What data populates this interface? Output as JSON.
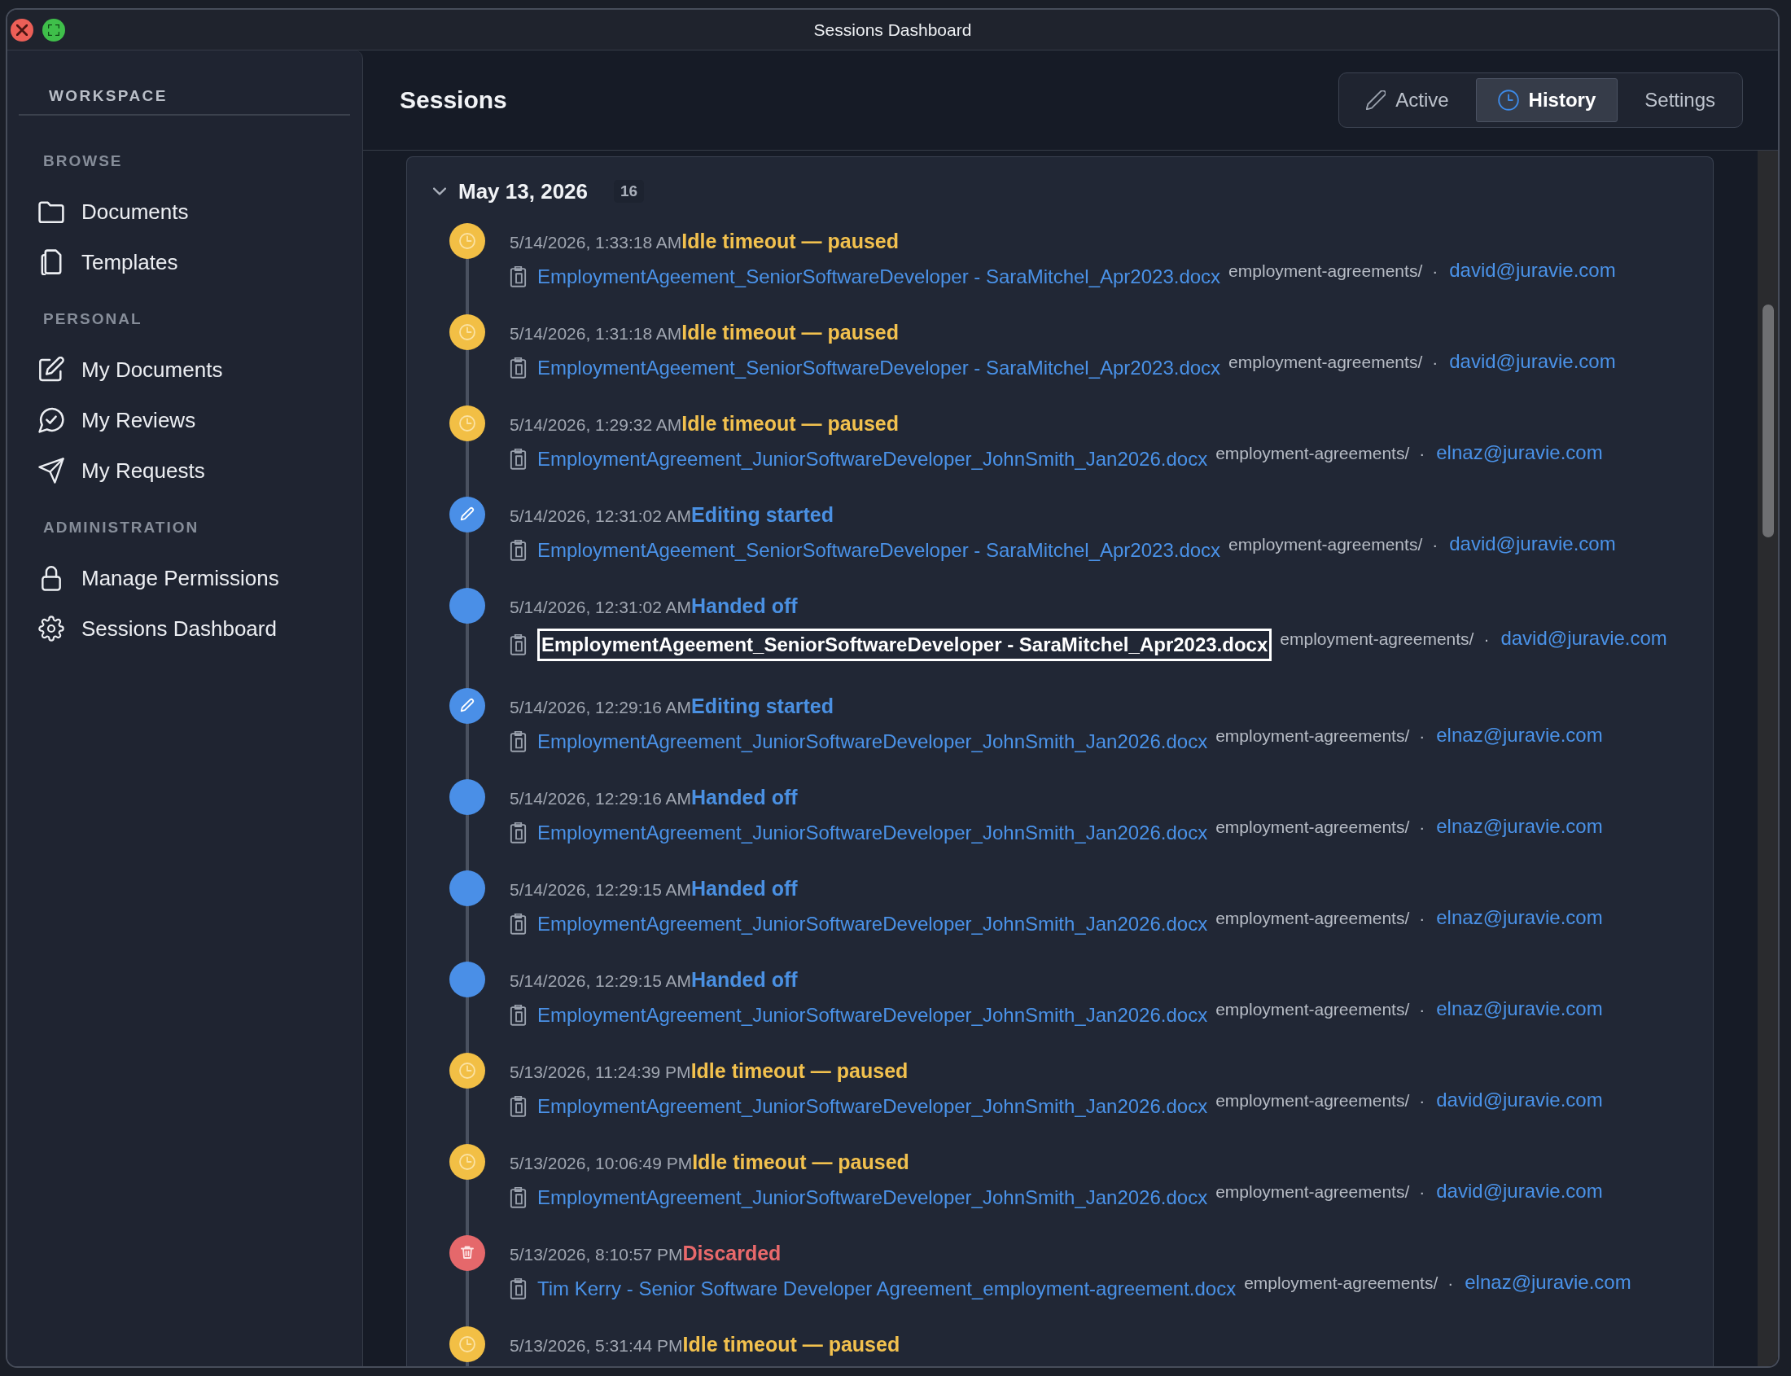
{
  "window": {
    "title": "Sessions Dashboard"
  },
  "sidebar": {
    "heading": "WORKSPACE",
    "sections": [
      {
        "label": "BROWSE",
        "items": [
          {
            "label": "Documents"
          },
          {
            "label": "Templates"
          }
        ]
      },
      {
        "label": "PERSONAL",
        "items": [
          {
            "label": "My Documents"
          },
          {
            "label": "My Reviews"
          },
          {
            "label": "My Requests"
          }
        ]
      },
      {
        "label": "ADMINISTRATION",
        "items": [
          {
            "label": "Manage Permissions"
          },
          {
            "label": "Sessions Dashboard"
          }
        ]
      }
    ]
  },
  "header": {
    "title": "Sessions",
    "tabs": [
      {
        "label": "Active",
        "selected": false
      },
      {
        "label": "History",
        "selected": true
      },
      {
        "label": "Settings",
        "selected": false
      }
    ]
  },
  "groups": [
    {
      "date": "May 13, 2026",
      "count": "16",
      "expanded": true,
      "events": [
        {
          "kind": "idle",
          "time": "5/14/2026, 1:33:18 AM",
          "title": "Idle timeout — paused",
          "file": "EmploymentAgeement_SeniorSoftwareDeveloper - SaraMitchel_Apr2023.docx",
          "folder": "employment-agreements/",
          "separator": "·",
          "user": "david@juravie.com",
          "selected": false
        },
        {
          "kind": "idle",
          "time": "5/14/2026, 1:31:18 AM",
          "title": "Idle timeout — paused",
          "file": "EmploymentAgeement_SeniorSoftwareDeveloper - SaraMitchel_Apr2023.docx",
          "folder": "employment-agreements/",
          "separator": "·",
          "user": "david@juravie.com",
          "selected": false
        },
        {
          "kind": "idle",
          "time": "5/14/2026, 1:29:32 AM",
          "title": "Idle timeout — paused",
          "file": "EmploymentAgreement_JuniorSoftwareDeveloper_JohnSmith_Jan2026.docx",
          "folder": "employment-agreements/",
          "separator": "·",
          "user": "elnaz@juravie.com",
          "selected": false
        },
        {
          "kind": "editing",
          "time": "5/14/2026, 12:31:02 AM",
          "title": "Editing started",
          "file": "EmploymentAgeement_SeniorSoftwareDeveloper - SaraMitchel_Apr2023.docx",
          "folder": "employment-agreements/",
          "separator": "·",
          "user": "david@juravie.com",
          "selected": false
        },
        {
          "kind": "handoff",
          "time": "5/14/2026, 12:31:02 AM",
          "title": "Handed off",
          "file": "EmploymentAgeement_SeniorSoftwareDeveloper - SaraMitchel_Apr2023.docx",
          "folder": "employment-agreements/",
          "separator": "·",
          "user": "david@juravie.com",
          "selected": true
        },
        {
          "kind": "editing",
          "time": "5/14/2026, 12:29:16 AM",
          "title": "Editing started",
          "file": "EmploymentAgreement_JuniorSoftwareDeveloper_JohnSmith_Jan2026.docx",
          "folder": "employment-agreements/",
          "separator": "·",
          "user": "elnaz@juravie.com",
          "selected": false
        },
        {
          "kind": "handoff",
          "time": "5/14/2026, 12:29:16 AM",
          "title": "Handed off",
          "file": "EmploymentAgreement_JuniorSoftwareDeveloper_JohnSmith_Jan2026.docx",
          "folder": "employment-agreements/",
          "separator": "·",
          "user": "elnaz@juravie.com",
          "selected": false
        },
        {
          "kind": "handoff",
          "time": "5/14/2026, 12:29:15 AM",
          "title": "Handed off",
          "file": "EmploymentAgreement_JuniorSoftwareDeveloper_JohnSmith_Jan2026.docx",
          "folder": "employment-agreements/",
          "separator": "·",
          "user": "elnaz@juravie.com",
          "selected": false
        },
        {
          "kind": "handoff",
          "time": "5/14/2026, 12:29:15 AM",
          "title": "Handed off",
          "file": "EmploymentAgreement_JuniorSoftwareDeveloper_JohnSmith_Jan2026.docx",
          "folder": "employment-agreements/",
          "separator": "·",
          "user": "elnaz@juravie.com",
          "selected": false
        },
        {
          "kind": "idle",
          "time": "5/13/2026, 11:24:39 PM",
          "title": "Idle timeout — paused",
          "file": "EmploymentAgreement_JuniorSoftwareDeveloper_JohnSmith_Jan2026.docx",
          "folder": "employment-agreements/",
          "separator": "·",
          "user": "david@juravie.com",
          "selected": false
        },
        {
          "kind": "idle",
          "time": "5/13/2026, 10:06:49 PM",
          "title": "Idle timeout — paused",
          "file": "EmploymentAgreement_JuniorSoftwareDeveloper_JohnSmith_Jan2026.docx",
          "folder": "employment-agreements/",
          "separator": "·",
          "user": "david@juravie.com",
          "selected": false
        },
        {
          "kind": "discarded",
          "time": "5/13/2026, 8:10:57 PM",
          "title": "Discarded",
          "file": "Tim Kerry - Senior Software Developer Agreement_employment-agreement.docx",
          "folder": "employment-agreements/",
          "separator": "·",
          "user": "elnaz@juravie.com",
          "selected": false
        },
        {
          "kind": "idle",
          "time": "5/13/2026, 5:31:44 PM",
          "title": "Idle timeout — paused"
        }
      ]
    }
  ]
}
